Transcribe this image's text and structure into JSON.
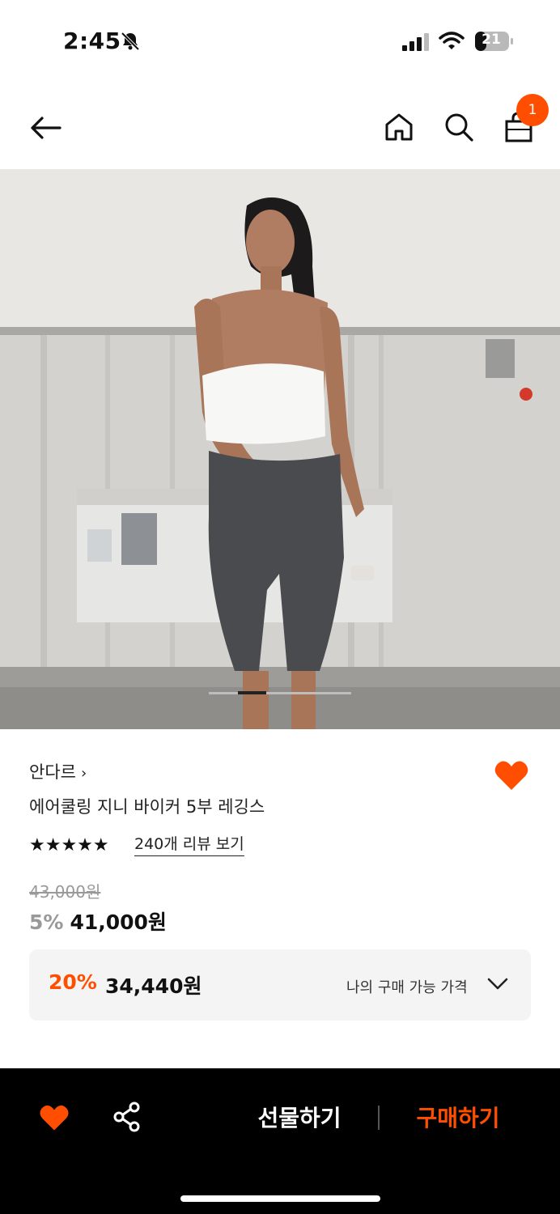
{
  "status": {
    "time": "2:45",
    "battery": "21"
  },
  "nav": {
    "cart_count": "1"
  },
  "product": {
    "brand": "안다르",
    "brand_chevron": "›",
    "name": "에어쿨링 지니 바이커 5부 레깅스",
    "stars": "★★★★★",
    "review_link": "240개 리뷰 보기",
    "original_price": "43,000원",
    "discount": "5%",
    "price": "41,000원"
  },
  "my_price": {
    "discount": "20%",
    "price": "34,440원",
    "label": "나의 구매 가능 가격"
  },
  "bottom_bar": {
    "gift_label": "선물하기",
    "buy_label": "구매하기"
  },
  "colors": {
    "accent": "#ff4e00",
    "bar_bg": "#000000"
  },
  "icons": [
    "bell-slash-icon",
    "signal-icon",
    "wifi-icon",
    "battery-icon",
    "back-arrow-icon",
    "home-icon",
    "search-icon",
    "shopping-bag-icon",
    "heart-icon",
    "share-icon",
    "chevron-down-icon"
  ]
}
